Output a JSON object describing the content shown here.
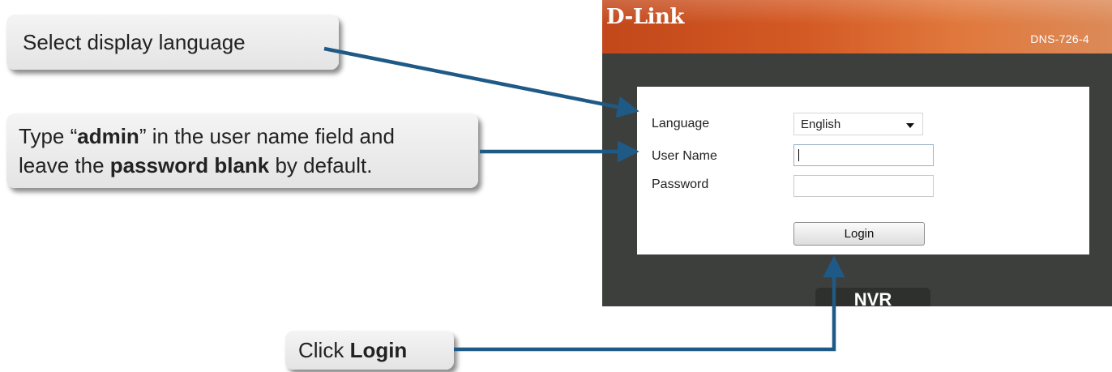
{
  "callouts": {
    "language": "Select display language",
    "admin": {
      "line1_pre": "Type “",
      "line1_bold": "admin",
      "line1_post": "” in the user name field and",
      "line2_pre": "leave the ",
      "line2_bold": "password blank",
      "line2_post": " by default."
    },
    "login": {
      "pre": "Click ",
      "bold": "Login"
    }
  },
  "device": {
    "brand": "D-Link",
    "model": "DNS-726-4",
    "footer": "NVR"
  },
  "login_form": {
    "language_label": "Language",
    "language_value": "English",
    "username_label": "User Name",
    "username_value": "",
    "password_label": "Password",
    "password_value": "",
    "login_button": "Login"
  },
  "colors": {
    "arrow": "#1f5a86",
    "header": "#d45a24",
    "panel": "#3d3f3c"
  },
  "icons": {
    "caret": "chevron-down-icon",
    "arrowhead": "arrow-icon"
  }
}
